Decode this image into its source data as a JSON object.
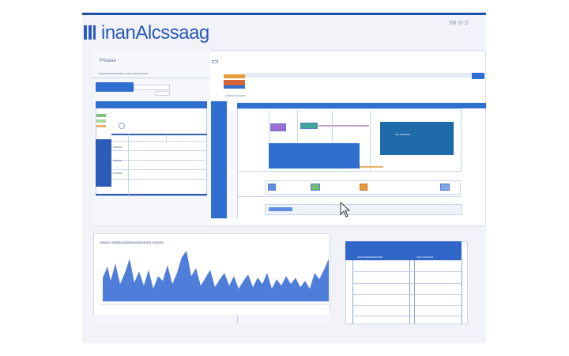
{
  "header": {
    "logo_text": "inanAlcssaag",
    "topright_text": "SB SI S"
  },
  "left_panel": {
    "title": "P4aaaa",
    "subtitle": "aaaaaaaaaaaaaaa aaa aaaaa aaaa",
    "sidebar_labels": [
      "aaaaa",
      "aaaaa",
      "aaaaa"
    ]
  },
  "middle_panel": {
    "status_text": "aaaaa aaaaaa"
  },
  "node_box": {
    "label": "aa aaaaaa"
  },
  "chart_panel": {
    "title": "aaaaa aaaaaaaaaaaaaaaaaa aaaaa"
  },
  "right_table": {
    "header_text": "aaa aaaaaaaaaaa",
    "header_right": "aaa aaaaaa"
  },
  "colors": {
    "brand_blue": "#2f6fd0",
    "dark_blue": "#1f4fa8",
    "accent_orange": "#e89a3a",
    "accent_green": "#6fbf73",
    "accent_purple": "#9c6cd0",
    "node_teal": "#1f6aa8"
  },
  "icons": [
    "logo-bars-icon",
    "cursor-pointer-icon"
  ]
}
